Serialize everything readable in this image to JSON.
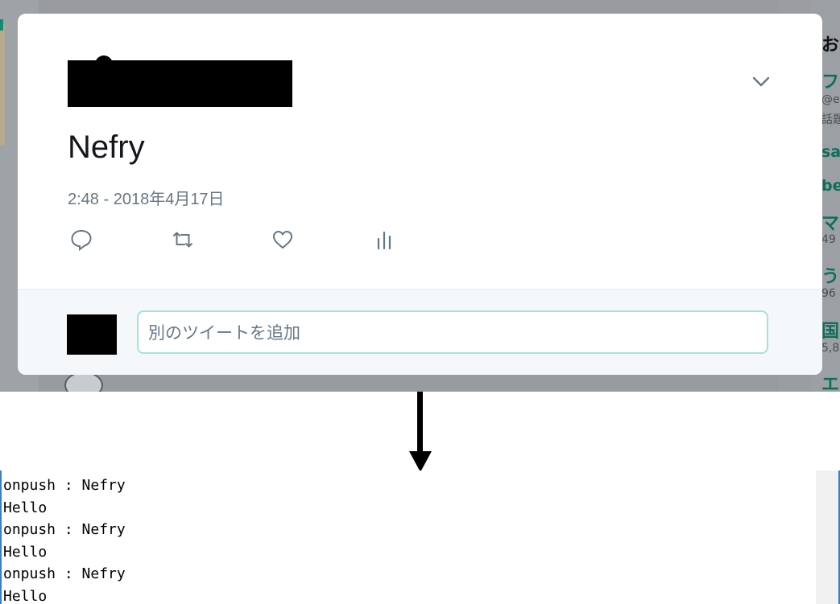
{
  "tweet_modal": {
    "text": "Nefry",
    "timestamp": "2:48 - 2018年4月17日",
    "actions": [
      "reply-icon",
      "retweet-icon",
      "like-icon",
      "analytics-icon"
    ],
    "reply_placeholder": "別のツイートを追加",
    "menu_icon": "chevron-down-icon"
  },
  "background_trends": [
    {
      "text": "おす",
      "style": "heading"
    },
    {
      "text": "フ",
      "style": "trend"
    },
    {
      "text": "@er",
      "style": "small"
    },
    {
      "text": "話題",
      "style": "small"
    },
    {
      "text": "sa",
      "style": "trend"
    },
    {
      "text": "be",
      "style": "trend"
    },
    {
      "text": "マ",
      "style": "trend"
    },
    {
      "text": "49",
      "style": "small"
    },
    {
      "text": "う",
      "style": "trend"
    },
    {
      "text": "96",
      "style": "small"
    },
    {
      "text": "国民",
      "style": "trend"
    },
    {
      "text": "5,8",
      "style": "small"
    },
    {
      "text": "エス",
      "style": "trend"
    }
  ],
  "console": {
    "lines": [
      "onpush : Nefry",
      "Hello",
      "onpush : Nefry",
      "Hello",
      "onpush : Nefry",
      "Hello"
    ]
  },
  "colors": {
    "accent_green": "#0e6e59",
    "input_border": "#a5e3d6",
    "muted_text": "#657786",
    "console_border": "#3a7fc0"
  }
}
